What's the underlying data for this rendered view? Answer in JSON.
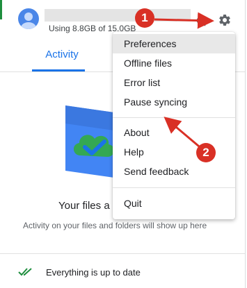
{
  "header": {
    "storage_text": "Using 8.8GB of 15.0GB"
  },
  "tabs": [
    {
      "label": "Activity"
    }
  ],
  "main": {
    "heading": "Your files a",
    "note": "Activity on your files and folders will show up here"
  },
  "footer": {
    "status": "Everything is up to date"
  },
  "menu": {
    "items": [
      {
        "label": "Preferences"
      },
      {
        "label": "Offline files"
      },
      {
        "label": "Error list"
      },
      {
        "label": "Pause syncing"
      },
      {
        "label": "About"
      },
      {
        "label": "Help"
      },
      {
        "label": "Send feedback"
      },
      {
        "label": "Quit"
      }
    ]
  },
  "annotations": {
    "badge_1": "1",
    "badge_2": "2"
  },
  "colors": {
    "accent": "#1a73e8",
    "annotation_red": "#d93025",
    "sync_green": "#1e8e3e"
  }
}
